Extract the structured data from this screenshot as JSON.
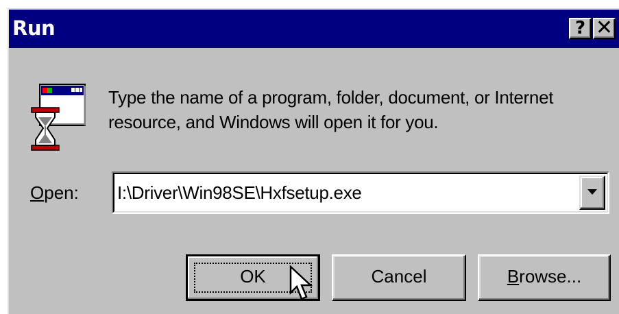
{
  "window": {
    "title": "Run",
    "help_button_label": "?",
    "close_button_label": "✕"
  },
  "icon": "run-hourglass-window-icon",
  "message": "Type the name of a program, folder, document, or Internet resource, and Windows will open it for you.",
  "open_field": {
    "label_mnemonic": "O",
    "label_rest": "pen:",
    "value": "I:\\Driver\\Win98SE\\Hxfsetup.exe"
  },
  "buttons": {
    "ok": "OK",
    "cancel": "Cancel",
    "browse_mnemonic": "B",
    "browse_rest": "rowse..."
  },
  "colors": {
    "titlebar": "#000080",
    "face": "#c0c0c0"
  }
}
